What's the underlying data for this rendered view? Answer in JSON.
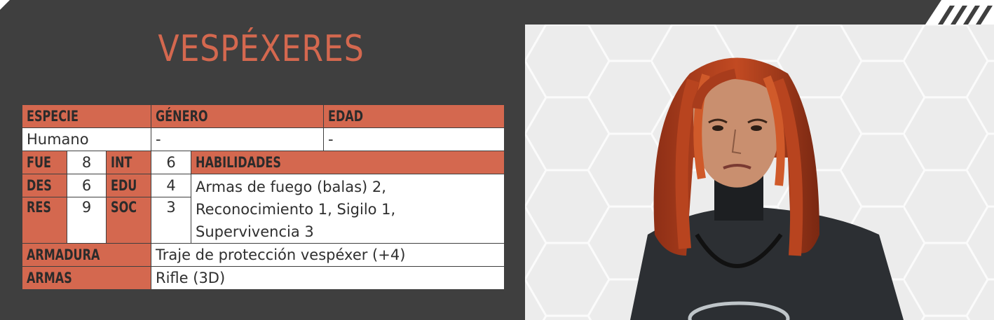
{
  "title": "VESPÉXERES",
  "headers": {
    "species": "ESPECIE",
    "gender": "GÉNERO",
    "age": "EDAD"
  },
  "values": {
    "species": "Humano",
    "gender": "-",
    "age": "-"
  },
  "stats": {
    "fue_label": "FUE",
    "fue": "8",
    "int_label": "INT",
    "int": "6",
    "des_label": "DES",
    "des": "6",
    "edu_label": "EDU",
    "edu": "4",
    "res_label": "RES",
    "res": "9",
    "soc_label": "SOC",
    "soc": "3"
  },
  "skills": {
    "label": "HABILIDADES",
    "line1": "Armas de fuego (balas) 2,",
    "line2": "Reconocimiento 1, Sigilo 1,",
    "line3": "Supervivencia 3"
  },
  "armor": {
    "label": "ARMADURA",
    "value": "Traje de protección vespéxer (+4)"
  },
  "weapons": {
    "label": "ARMAS",
    "value": "Rifle (3D)"
  },
  "colors": {
    "accent": "#d4684f",
    "panel": "#3f3f3f"
  }
}
